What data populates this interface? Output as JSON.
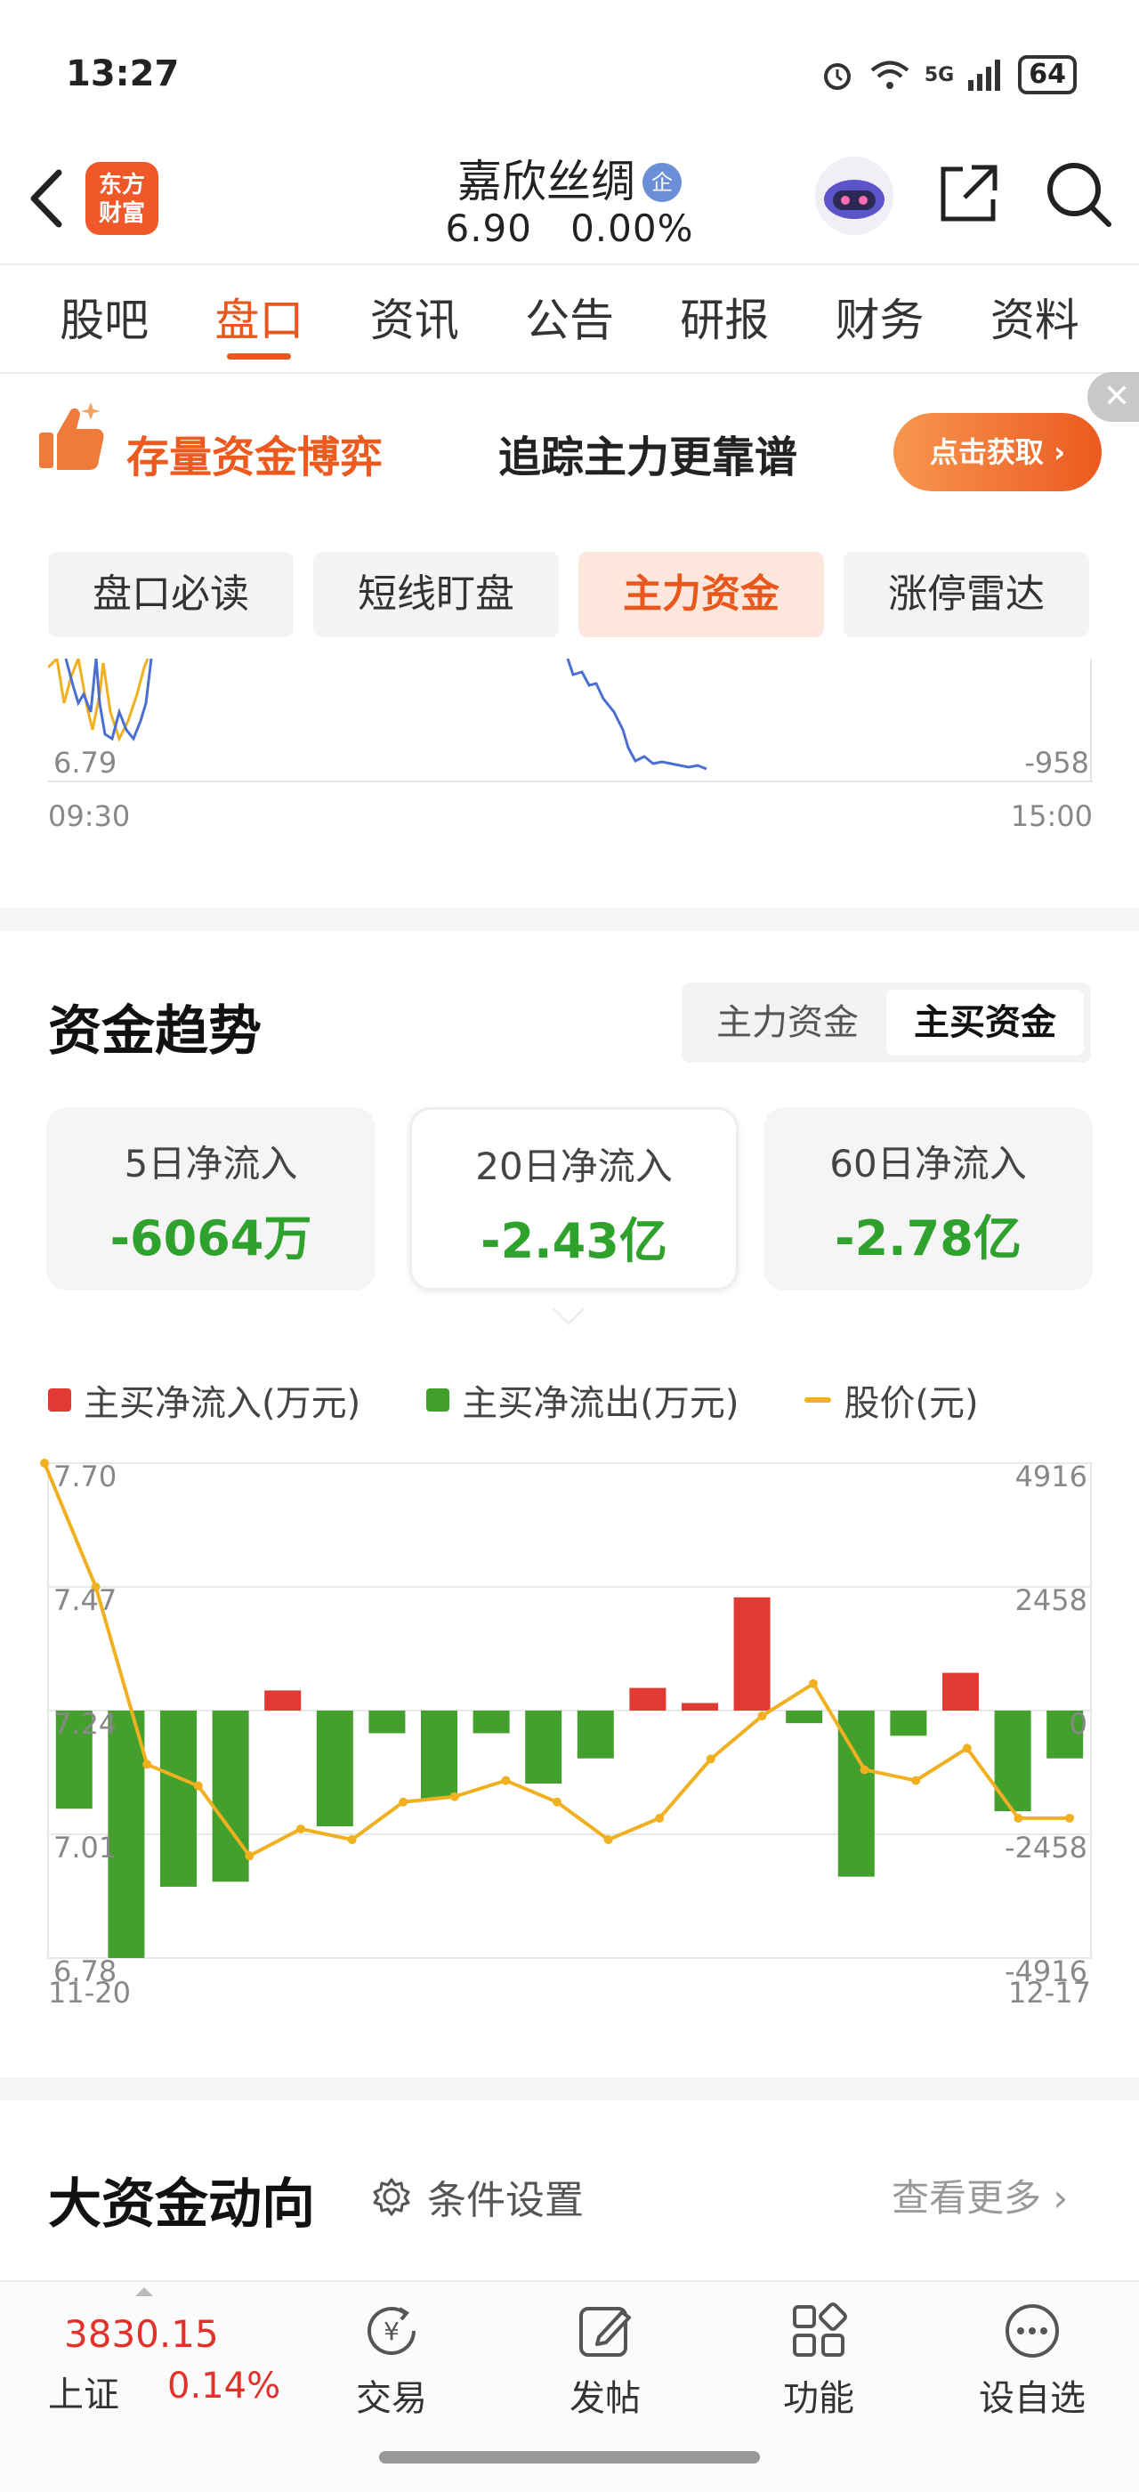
{
  "status_bar": {
    "time": "13:27",
    "network": "5G",
    "battery": "64"
  },
  "header": {
    "logo_text_line1": "东方",
    "logo_text_line2": "财富",
    "stock_name": "嘉欣丝绸",
    "stock_badge": "企",
    "price": "6.90",
    "change": "0.00%"
  },
  "tabs": [
    "股吧",
    "盘口",
    "资讯",
    "公告",
    "研报",
    "财务",
    "资料"
  ],
  "active_tab": "盘口",
  "promo": {
    "title": "存量资金博弈",
    "subtitle": "追踪主力更靠谱",
    "button": "点击获取 ›",
    "close": "✕"
  },
  "subtabs": [
    "盘口必读",
    "短线盯盘",
    "主力资金",
    "涨停雷达"
  ],
  "active_subtab": "主力资金",
  "top_chart": {
    "y_left_low": "6.79",
    "y_right_low": "-958",
    "x_start": "09:30",
    "x_end": "15:00"
  },
  "trend": {
    "title": "资金趋势",
    "toggle": [
      "主力资金",
      "主买资金"
    ],
    "toggle_active": "主买资金",
    "cards": [
      {
        "label": "5日净流入",
        "value": "-6064万"
      },
      {
        "label": "20日净流入",
        "value": "-2.43亿"
      },
      {
        "label": "60日净流入",
        "value": "-2.78亿"
      }
    ],
    "legend": [
      "主买净流入(万元)",
      "主买净流出(万元)",
      "股价(元)"
    ]
  },
  "chart_data": {
    "type": "bar",
    "x_start": "11-20",
    "x_end": "12-17",
    "left_ticks": [
      "7.70",
      "7.47",
      "7.24",
      "7.01",
      "6.78"
    ],
    "right_ticks": [
      "4916",
      "2458",
      "0",
      "-2458",
      "-4916"
    ],
    "ylim_left": [
      6.78,
      7.7
    ],
    "ylim_right": [
      -4916,
      4916
    ],
    "series": [
      {
        "name": "主买净流入(万元)",
        "color": "#e03a32"
      },
      {
        "name": "主买净流出(万元)",
        "color": "#44a02c"
      },
      {
        "name": "股价(元)",
        "color": "#f0b020"
      }
    ],
    "flows": [
      -1950,
      -4916,
      -3500,
      -3400,
      400,
      -2300,
      -450,
      -1750,
      -450,
      -1450,
      -950,
      450,
      150,
      2250,
      -250,
      -3300,
      -500,
      750,
      -2000,
      -950
    ],
    "prices": [
      7.7,
      7.47,
      7.14,
      7.1,
      6.97,
      7.02,
      7.0,
      7.07,
      7.08,
      7.11,
      7.07,
      7.0,
      7.04,
      7.15,
      7.23,
      7.29,
      7.13,
      7.11,
      7.17,
      7.04,
      7.04
    ]
  },
  "big_money": {
    "title": "大资金动向",
    "settings": "条件设置",
    "more": "查看更多 ›"
  },
  "bottom_nav": {
    "index_value": "3830.15",
    "index_name": "上证",
    "index_change": "0.14%",
    "items": [
      "交易",
      "发帖",
      "功能",
      "设自选"
    ]
  }
}
